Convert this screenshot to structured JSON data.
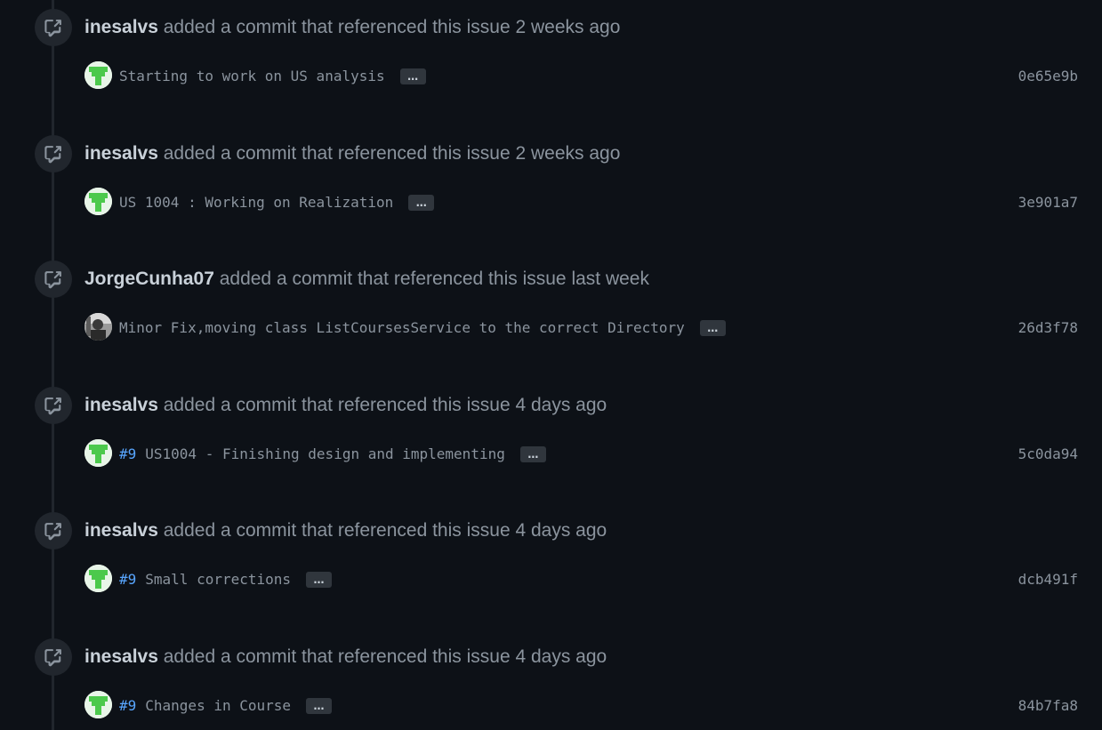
{
  "events": [
    {
      "author": "inesalvs",
      "action": "added a commit that referenced this issue",
      "time": "2 weeks ago",
      "avatar": "green-identicon",
      "issue_ref": "",
      "commit_message": "Starting to work on US analysis",
      "ellipsis": "…",
      "sha": "0e65e9b"
    },
    {
      "author": "inesalvs",
      "action": "added a commit that referenced this issue",
      "time": "2 weeks ago",
      "avatar": "green-identicon",
      "issue_ref": "",
      "commit_message": "US 1004 : Working on Realization",
      "ellipsis": "…",
      "sha": "3e901a7"
    },
    {
      "author": "JorgeCunha07",
      "action": "added a commit that referenced this issue",
      "time": "last week",
      "avatar": "photo-avatar",
      "issue_ref": "",
      "commit_message": "Minor Fix,moving class ListCoursesService to the correct Directory",
      "ellipsis": "…",
      "sha": "26d3f78"
    },
    {
      "author": "inesalvs",
      "action": "added a commit that referenced this issue",
      "time": "4 days ago",
      "avatar": "green-identicon",
      "issue_ref": "#9",
      "commit_message": "US1004 - Finishing design and implementing",
      "ellipsis": "…",
      "sha": "5c0da94"
    },
    {
      "author": "inesalvs",
      "action": "added a commit that referenced this issue",
      "time": "4 days ago",
      "avatar": "green-identicon",
      "issue_ref": "#9",
      "commit_message": "Small corrections",
      "ellipsis": "…",
      "sha": "dcb491f"
    },
    {
      "author": "inesalvs",
      "action": "added a commit that referenced this issue",
      "time": "4 days ago",
      "avatar": "green-identicon",
      "issue_ref": "#9",
      "commit_message": "Changes in Course",
      "ellipsis": "…",
      "sha": "84b7fa8"
    }
  ],
  "colors": {
    "background": "#0d1117",
    "text_muted": "#8b949e",
    "text_author": "#c9d1d9",
    "link": "#58a6ff",
    "badge": "#21262d",
    "identicon_green": "#4cc94c"
  }
}
